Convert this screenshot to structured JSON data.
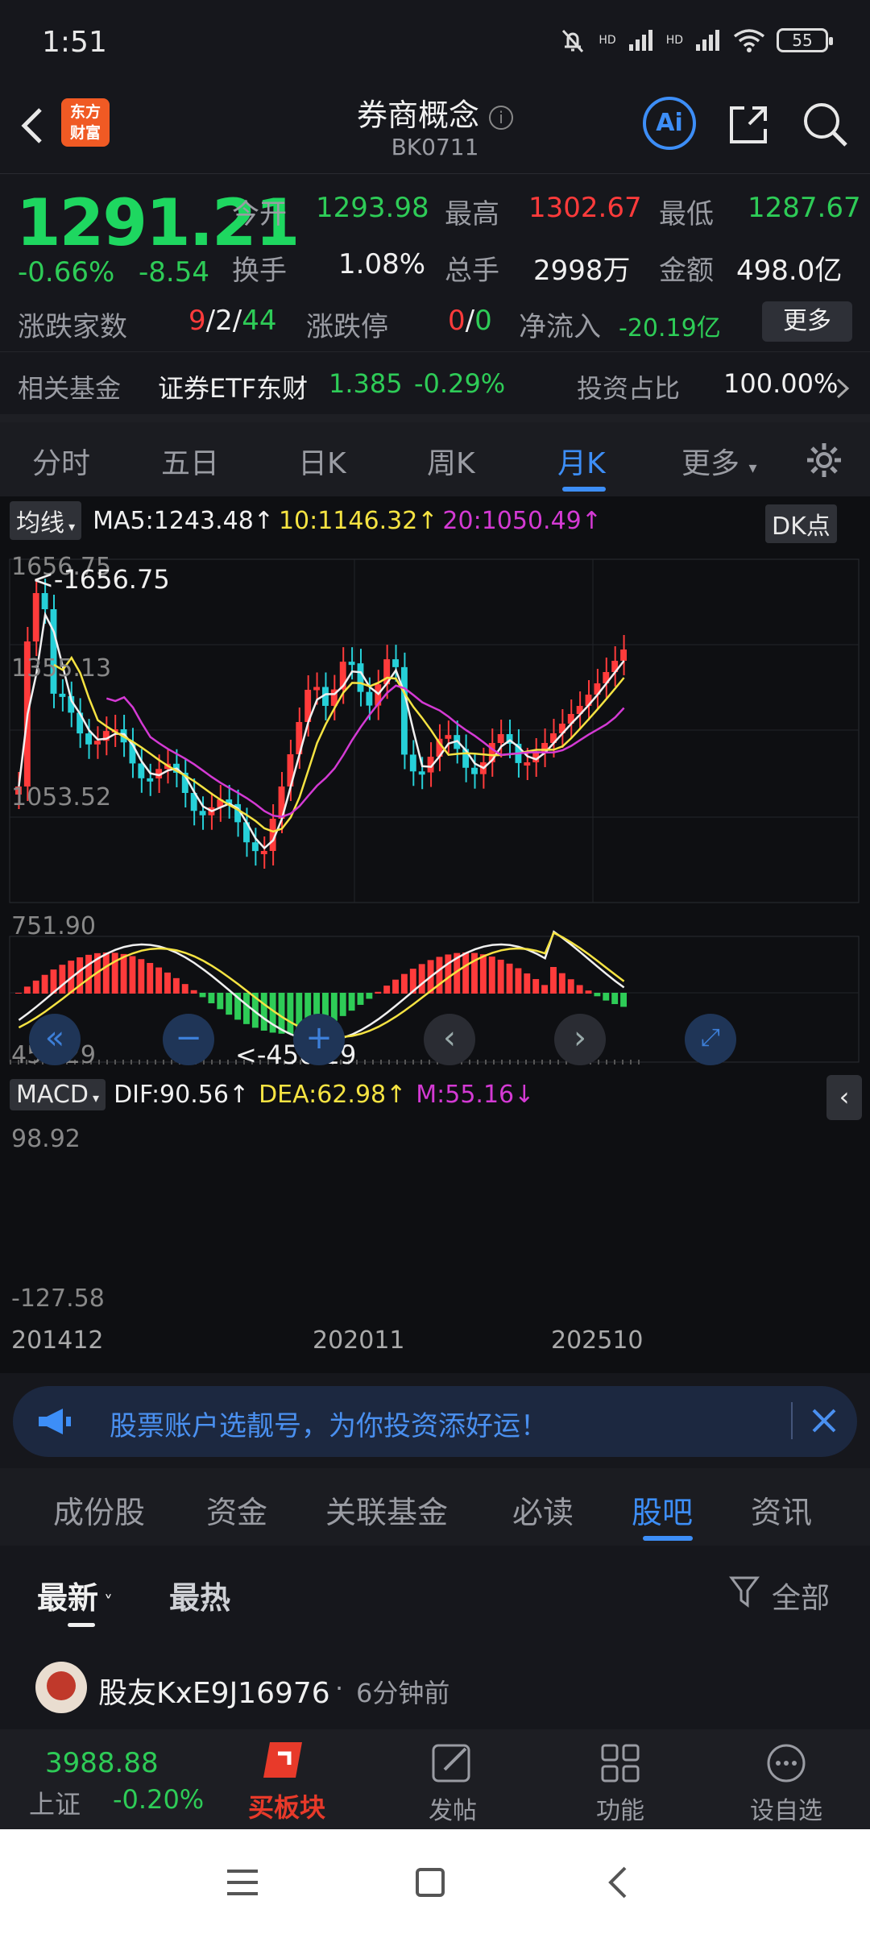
{
  "status": {
    "time": "1:51",
    "battery": "55",
    "net1": "HD",
    "net2": "HD"
  },
  "header": {
    "logo_line1": "东方",
    "logo_line2": "财富",
    "title": "券商概念",
    "code": "BK0711",
    "ai_label": "Ai"
  },
  "quote": {
    "price": "1291.21",
    "change_pct": "-0.66%",
    "change": "-8.54",
    "open_label": "今开",
    "open": "1293.98",
    "high_label": "最高",
    "high": "1302.67",
    "low_label": "最低",
    "low": "1287.67",
    "turnover_label": "换手",
    "turnover": "1.08%",
    "volume_label": "总手",
    "volume": "2998万",
    "amount_label": "金额",
    "amount": "498.0亿",
    "breadth_label": "涨跌家数",
    "up": "9",
    "flat": "2",
    "down": "44",
    "slash": "/",
    "limit_label": "涨跌停",
    "limit_up": "0",
    "limit_down": "0",
    "netflow_label": "净流入",
    "netflow": "-20.19亿",
    "more": "更多"
  },
  "fund": {
    "label": "相关基金",
    "name": "证券ETF东财",
    "price": "1.385",
    "change": "-0.29%",
    "ratio_label": "投资占比",
    "ratio": "100.00%"
  },
  "tabs": [
    "分时",
    "五日",
    "日K",
    "周K",
    "月K",
    "更多"
  ],
  "chart": {
    "ma_selector": "均线",
    "ma5": "MA5:1243.48",
    "ma10": "10:1146.32",
    "ma20": "20:1050.49",
    "dk": "DK点",
    "max_label": "<-1656.75",
    "min_label": "<-450.29",
    "y_labels": [
      "1656.75",
      "1355.13",
      "1053.52",
      "751.90",
      "450.29"
    ],
    "macd_selector": "MACD",
    "dif": "DIF:90.56",
    "dea": "DEA:62.98",
    "m": "M:55.16",
    "macd_top": "98.92",
    "macd_bottom": "-127.58",
    "x_labels": [
      "201412",
      "202011",
      "202510"
    ],
    "up_color": "#ff3b3b",
    "down_color": "#26d0d8"
  },
  "banner": {
    "text": "股票账户选靓号，为你投资添好运！"
  },
  "section_tabs": [
    "成份股",
    "资金",
    "关联基金",
    "必读",
    "股吧",
    "资讯"
  ],
  "post": {
    "sort_new": "最新",
    "sort_hot": "最热",
    "filter": "全部",
    "user": "股友KxE9J16976",
    "time": "6分钟前",
    "dot": "·"
  },
  "bottom_nav": {
    "index_value": "3988.88",
    "index_name": "上证",
    "index_change": "-0.20%",
    "buy": "买板块",
    "post": "发帖",
    "func": "功能",
    "fav": "设自选"
  }
}
